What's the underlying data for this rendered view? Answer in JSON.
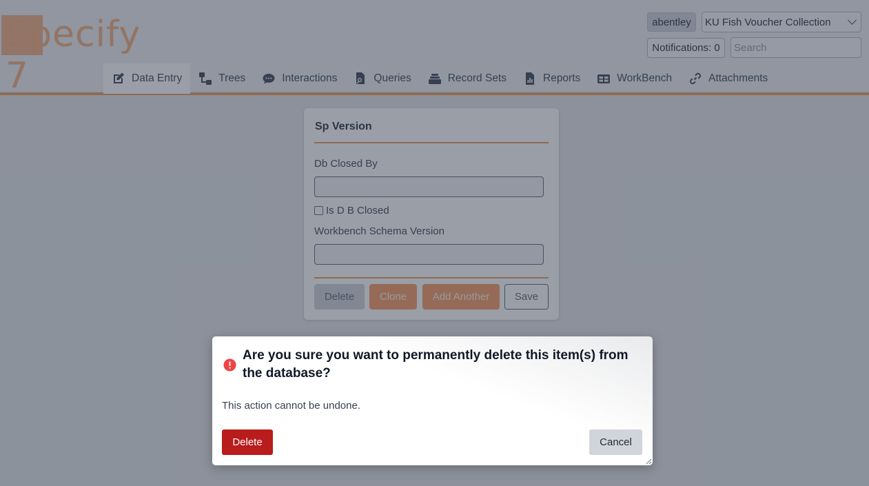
{
  "header": {
    "logo_text": "Specify 7",
    "user_button": "abentley",
    "collection_select": "KU Fish Voucher Collection",
    "notifications_label": "Notifications: 0",
    "search_placeholder": "Search"
  },
  "nav": {
    "items": [
      {
        "label": "Data Entry",
        "icon": "edit-icon",
        "active": true
      },
      {
        "label": "Trees",
        "icon": "tree-icon"
      },
      {
        "label": "Interactions",
        "icon": "chat-icon"
      },
      {
        "label": "Queries",
        "icon": "query-icon"
      },
      {
        "label": "Record Sets",
        "icon": "stack-icon"
      },
      {
        "label": "Reports",
        "icon": "report-icon"
      },
      {
        "label": "WorkBench",
        "icon": "table-icon"
      },
      {
        "label": "Attachments",
        "icon": "link-icon"
      }
    ]
  },
  "form": {
    "title": "Sp Version",
    "fields": [
      {
        "label": "Db Closed By",
        "value": ""
      },
      {
        "label": "Workbench Schema Version",
        "value": ""
      }
    ],
    "checkbox_label": "Is D B Closed",
    "buttons": {
      "delete": "Delete",
      "clone": "Clone",
      "add_another": "Add Another",
      "save": "Save"
    }
  },
  "dialog": {
    "title": "Are you sure you want to permanently delete this item(s) from the database?",
    "message": "This action cannot be undone.",
    "delete_label": "Delete",
    "cancel_label": "Cancel"
  },
  "colors": {
    "accent": "#e7a26b",
    "danger": "#b91c1c",
    "warning_icon": "#ef4444"
  }
}
